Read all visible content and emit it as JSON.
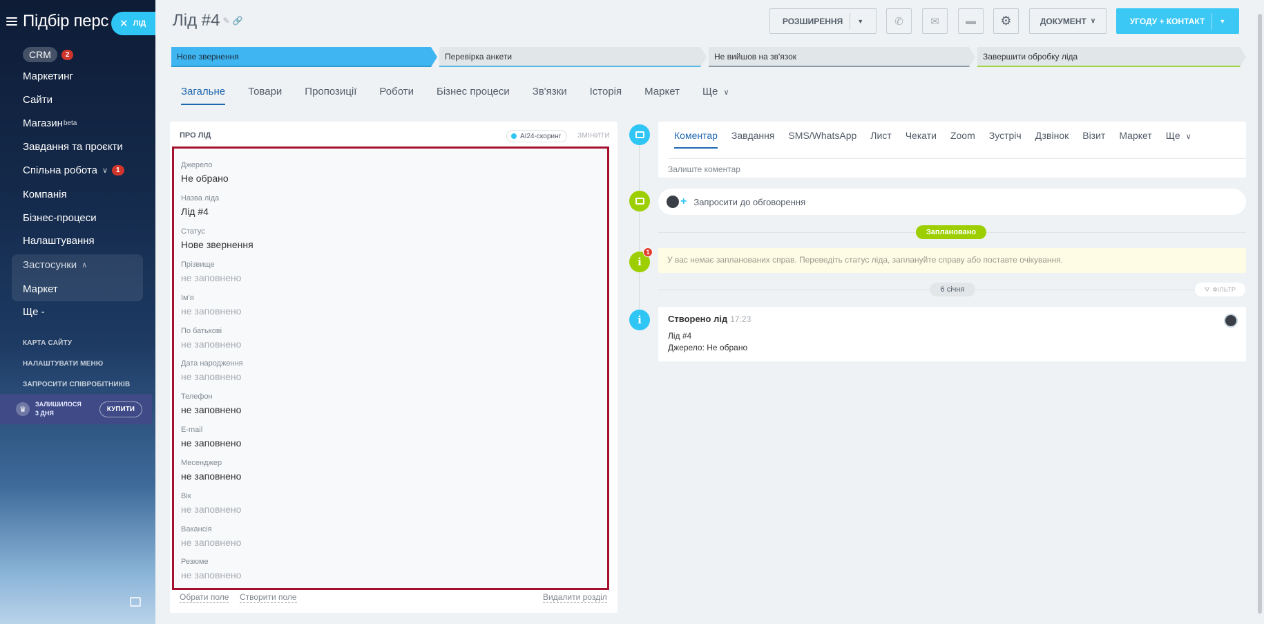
{
  "sidebar": {
    "title": "Підбір перс",
    "lead_pill": "ЛІД",
    "items": [
      {
        "label": "CRM",
        "counter": "2"
      },
      {
        "label": "Маркетинг"
      },
      {
        "label": "Сайти"
      },
      {
        "label": "Магазин",
        "sup": "beta"
      },
      {
        "label": "Завдання та проєкти"
      },
      {
        "label": "Спільна робота",
        "counter": "1"
      },
      {
        "label": "Компанія"
      },
      {
        "label": "Бізнес-процеси"
      },
      {
        "label": "Налаштування"
      },
      {
        "label": "Застосунки"
      },
      {
        "label": "Маркет"
      },
      {
        "label": "Ще -"
      }
    ],
    "links": [
      "КАРТА САЙТУ",
      "НАЛАШТУВАТИ МЕНЮ",
      "ЗАПРОСИТИ СПІВРОБІТНИКІВ"
    ],
    "trial_line1": "ЗАЛИШИЛОСЯ",
    "trial_line2": "3 ДНЯ",
    "buy_label": "КУПИТИ"
  },
  "header": {
    "title": "Лід #4",
    "extensions_label": "РОЗШИРЕННЯ",
    "document_label": "ДОКУМЕНТ",
    "deal_contact_label": "УГОДУ + КОНТАКТ"
  },
  "stages": [
    {
      "label": "Нове звернення",
      "active": true
    },
    {
      "label": "Перевірка анкети"
    },
    {
      "label": "Не вийшов на зв'язок"
    },
    {
      "label": "Завершити обробку ліда"
    }
  ],
  "tabs": [
    "Загальне",
    "Товари",
    "Пропозиції",
    "Роботи",
    "Бізнес процеси",
    "Зв'язки",
    "Історія",
    "Маркет",
    "Ще"
  ],
  "about": {
    "heading": "ПРО ЛІД",
    "ai_badge": "AI24-скоринг",
    "change_label": "ЗМІНИТИ",
    "fields": [
      {
        "label": "Джерело",
        "value": "Не обрано",
        "empty": false
      },
      {
        "label": "Назва ліда",
        "value": "Лід #4",
        "empty": false
      },
      {
        "label": "Статус",
        "value": "Нове звернення",
        "empty": false
      },
      {
        "label": "Прізвище",
        "value": "не заповнено",
        "empty": true
      },
      {
        "label": "Ім'я",
        "value": "не заповнено",
        "empty": true
      },
      {
        "label": "По батькові",
        "value": "не заповнено",
        "empty": true
      },
      {
        "label": "Дата народження",
        "value": "не заповнено",
        "empty": true
      },
      {
        "label": "Телефон",
        "value": "не заповнено",
        "empty": false
      },
      {
        "label": "E-mail",
        "value": "не заповнено",
        "empty": false
      },
      {
        "label": "Месенджер",
        "value": "не заповнено",
        "empty": false
      },
      {
        "label": "Вік",
        "value": "не заповнено",
        "empty": true
      },
      {
        "label": "Вакансія",
        "value": "не заповнено",
        "empty": true
      },
      {
        "label": "Резюме",
        "value": "не заповнено",
        "empty": true
      }
    ],
    "select_field": "Обрати поле",
    "create_field": "Створити поле",
    "delete_section": "Видалити розділ"
  },
  "timeline": {
    "editor_tabs": [
      "Коментар",
      "Завдання",
      "SMS/WhatsApp",
      "Лист",
      "Чекати",
      "Zoom",
      "Зустріч",
      "Дзвінок",
      "Візит",
      "Маркет",
      "Ще"
    ],
    "comment_placeholder": "Залиште коментар",
    "invite_label": "Запросити до обговорення",
    "planned_label": "Заплановано",
    "warning_count": "1",
    "warning_text": "У вас немає запланованих справ. Переведіть статус ліда, заплануйте справу або поставте очікування.",
    "date_label": "6 січня",
    "filter_label": "ФІЛЬТР",
    "created_title": "Створено лід",
    "created_time": "17:23",
    "created_line1": "Лід #4",
    "created_line2": "Джерело: Не обрано"
  }
}
